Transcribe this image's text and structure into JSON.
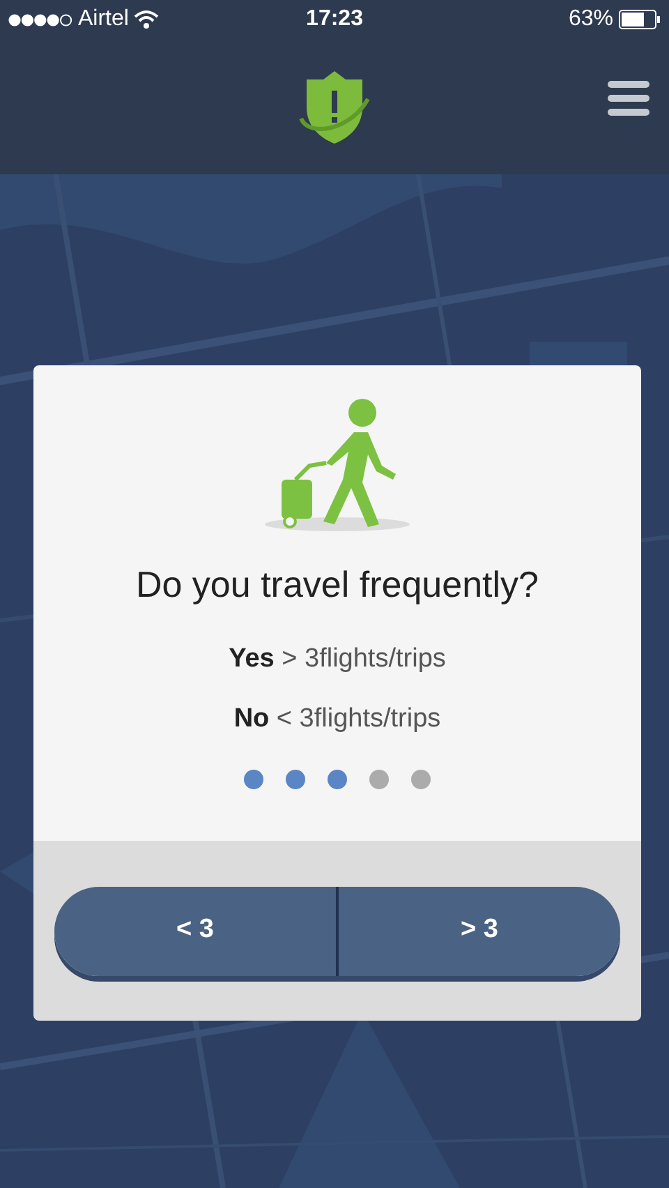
{
  "status_bar": {
    "carrier": "Airtel",
    "time": "17:23",
    "battery": "63%"
  },
  "dialog": {
    "question": "Do you travel frequently?",
    "hints": [
      "**Yes** > 3flights/trips",
      "**No** < 3flights/trips"
    ],
    "steps": [
      {
        "active": true
      },
      {
        "active": true
      },
      {
        "active": true
      },
      {
        "active": false
      },
      {
        "active": false
      }
    ],
    "buttons": [
      "< 3",
      "> 3"
    ]
  }
}
